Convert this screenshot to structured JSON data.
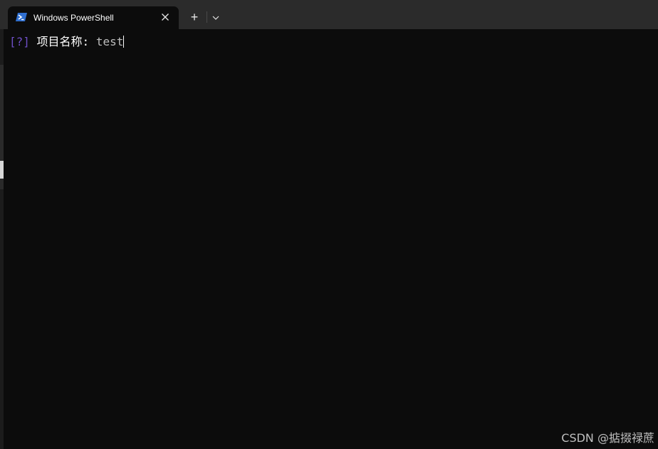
{
  "tab": {
    "title": "Windows PowerShell",
    "icon": "powershell-icon",
    "close_icon": "close-icon"
  },
  "toolbar": {
    "new_tab_symbol": "+",
    "new_tab_icon": "plus-icon",
    "dropdown_icon": "chevron-down-icon"
  },
  "terminal": {
    "prompt_marker": "[?]",
    "prompt_label": "项目名称:",
    "input_value": "test"
  },
  "watermark": {
    "text": "CSDN @掂掇禄蔗"
  },
  "colors": {
    "titlebar": "#2b2b2b",
    "terminal_bg": "#0c0c0c",
    "prompt_marker": "#6e4fc7"
  }
}
